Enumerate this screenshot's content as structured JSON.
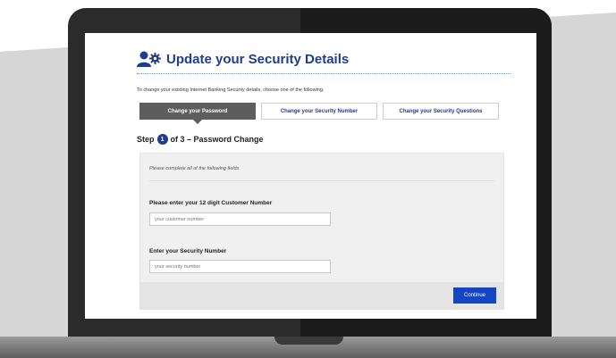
{
  "page": {
    "title": "Update your Security Details",
    "intro": "To change your existing Internet Banking Security details, choose one of the following."
  },
  "tabs": [
    {
      "label": "Change your Password",
      "active": true
    },
    {
      "label": "Change your Security Number",
      "active": false
    },
    {
      "label": "Change your Security Questions",
      "active": false
    }
  ],
  "step": {
    "prefix": "Step",
    "number": "1",
    "suffix": "of 3 – Password Change"
  },
  "form": {
    "note": "Please complete all of the following fields",
    "customer_number": {
      "label": "Please enter your 12 digit Customer Number",
      "placeholder": "your customer number",
      "value": ""
    },
    "security_number": {
      "label": "Enter your Security Number",
      "placeholder": "your security number",
      "value": ""
    },
    "continue_label": "Continue"
  },
  "colors": {
    "brand": "#1e3d8f",
    "button": "#1446c4",
    "active_tab": "#5d5d5d"
  },
  "icons": [
    "user-settings-icon"
  ]
}
